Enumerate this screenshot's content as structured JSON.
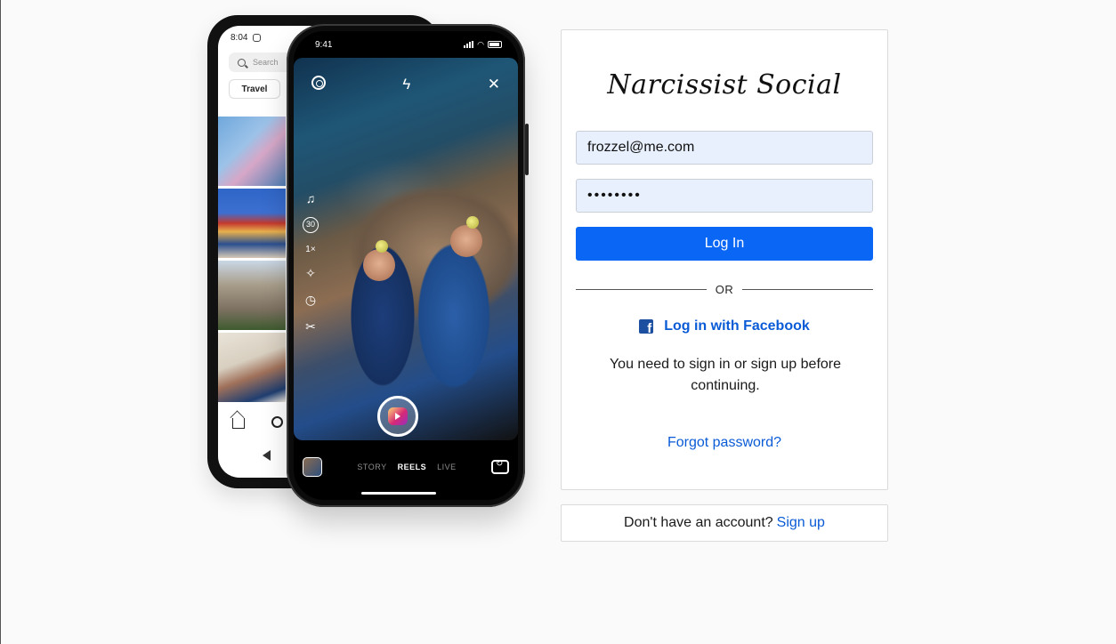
{
  "phone_back": {
    "time": "8:04",
    "search_placeholder": "Search",
    "chip": "Travel"
  },
  "phone_front": {
    "time": "9:41",
    "tool_timer": "30",
    "tool_speed": "1×",
    "modes": [
      "STORY",
      "REELS",
      "LIVE"
    ],
    "active_mode": "REELS"
  },
  "login": {
    "logo": "Narcissist Social",
    "email_value": "frozzel@me.com",
    "password_value": "••••••••",
    "login_button": "Log In",
    "divider": "OR",
    "facebook_label": "Log in with Facebook",
    "notice": "You need to sign in or sign up before continuing.",
    "forgot": "Forgot password?"
  },
  "signup": {
    "prompt": "Don't have an account?",
    "link": "Sign up"
  },
  "colors": {
    "accent": "#0a66f5",
    "link": "#0a5bd6",
    "input_bg": "#e8f0fe",
    "page_bg": "#fafafa"
  }
}
